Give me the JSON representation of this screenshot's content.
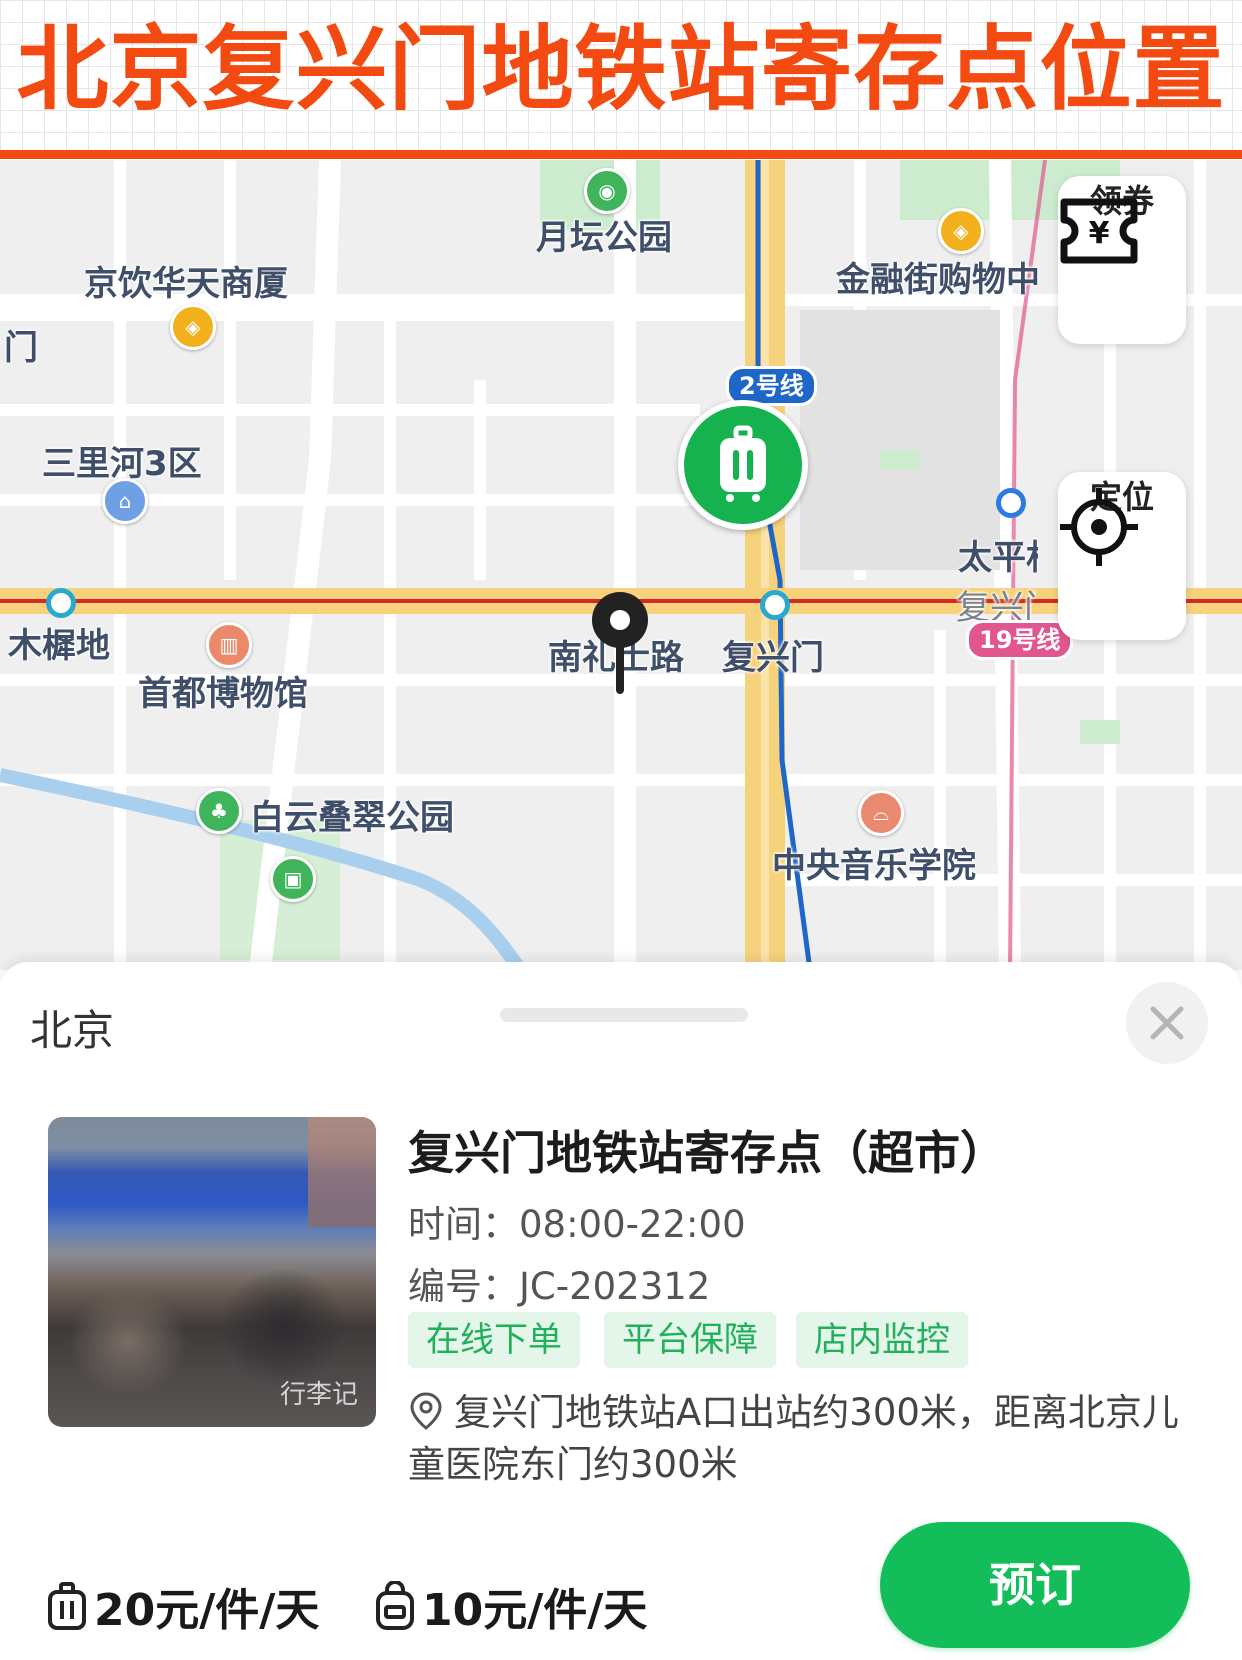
{
  "banner": {
    "title": "北京复兴门地铁站寄存点位置"
  },
  "map": {
    "labels": {
      "yuetan_park": "月坛公园",
      "jingyin": "京饮华天商厦",
      "jinrongjie": "金融街购物中",
      "men_partial": "门",
      "sanlihe": "三里河3区",
      "taiping_partial": "太平村",
      "muxidi": "木樨地",
      "museum": "首都博物馆",
      "nanlishilu": "南礼士路",
      "fuxingmen": "复兴门",
      "fuxingmenwai_partial": "复兴门外大街",
      "baiyun_park": "白云叠翠公园",
      "conservatory": "中央音乐学院"
    },
    "line_badges": {
      "line2": "2号线",
      "line19": "19号线"
    },
    "buttons": {
      "coupon": "领券",
      "locate": "定位"
    },
    "colors": {
      "line2": "#1f66c9",
      "line19": "#e2568f",
      "line1": "#d42a2a",
      "accent_green": "#15b24f"
    }
  },
  "sheet": {
    "city": "北京",
    "photo_watermark": "行李记",
    "store_name": "复兴门地铁站寄存点（超市）",
    "hours_label": "时间：",
    "hours_value": "08:00-22:00",
    "code_label": "编号：",
    "code_value": "JC-202312",
    "tags": [
      "在线下单",
      "平台保障",
      "店内监控"
    ],
    "address": "复兴门地铁站A口出站约300米，距离北京儿童医院东门约300米",
    "prices": [
      {
        "icon": "suitcase-icon",
        "text": "20元/件/天"
      },
      {
        "icon": "backpack-icon",
        "text": "10元/件/天"
      }
    ],
    "book_button": "预订"
  }
}
